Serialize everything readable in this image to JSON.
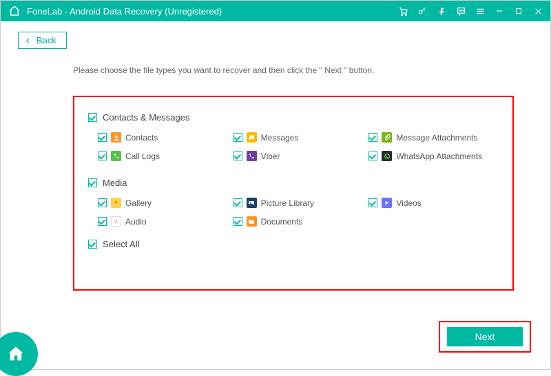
{
  "titlebar": {
    "title": "FoneLab - Android Data Recovery (Unregistered)"
  },
  "back": {
    "label": "Back"
  },
  "instruction": "Please choose the file types you want to recover and then click the \" Next \" button.",
  "group_contacts": {
    "header": "Contacts & Messages",
    "items": [
      {
        "label": "Contacts"
      },
      {
        "label": "Messages"
      },
      {
        "label": "Message Attachments"
      },
      {
        "label": "Call Logs"
      },
      {
        "label": "Viber"
      },
      {
        "label": "WhatsApp Attachments"
      }
    ]
  },
  "group_media": {
    "header": "Media",
    "items": [
      {
        "label": "Gallery"
      },
      {
        "label": "Picture Library"
      },
      {
        "label": "Videos"
      },
      {
        "label": "Audio"
      },
      {
        "label": "Documents"
      }
    ]
  },
  "select_all": {
    "label": "Select All"
  },
  "next": {
    "label": "Next"
  }
}
